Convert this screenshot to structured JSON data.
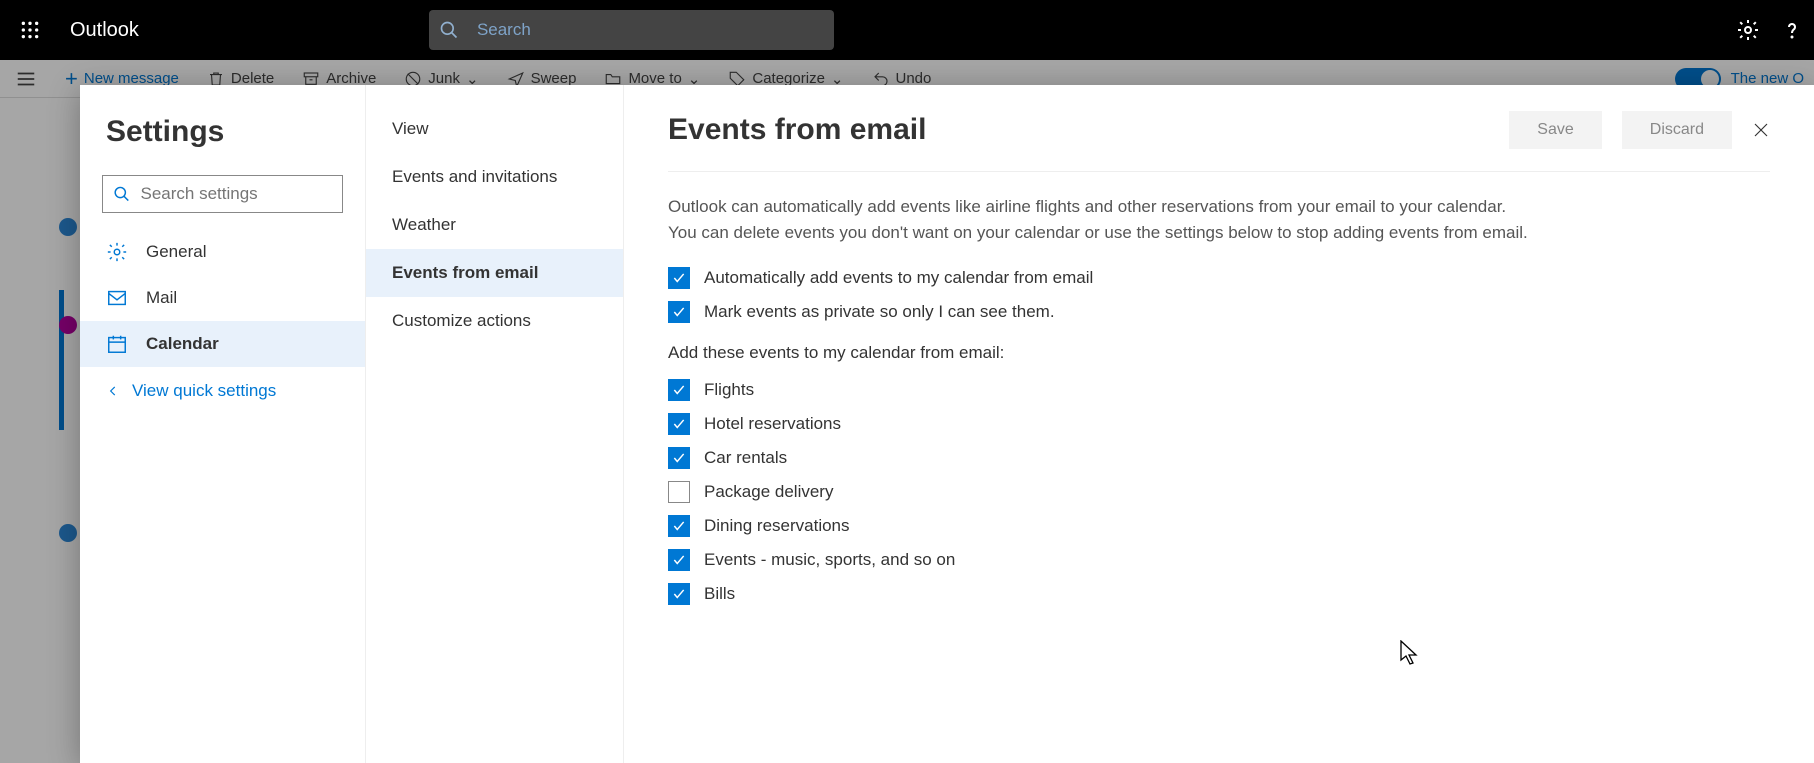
{
  "header": {
    "app_name": "Outlook",
    "search_placeholder": "Search"
  },
  "toolbar": {
    "new_message": "New message",
    "delete": "Delete",
    "archive": "Archive",
    "junk": "Junk",
    "sweep": "Sweep",
    "move_to": "Move to",
    "categorize": "Categorize",
    "undo": "Undo",
    "new_toggle_label": "The new O"
  },
  "settings": {
    "title": "Settings",
    "search_placeholder": "Search settings",
    "nav": {
      "general": "General",
      "mail": "Mail",
      "calendar": "Calendar"
    },
    "quick": "View quick settings"
  },
  "subnav": {
    "view": "View",
    "events_invitations": "Events and invitations",
    "weather": "Weather",
    "events_from_email": "Events from email",
    "customize_actions": "Customize actions"
  },
  "panel": {
    "title": "Events from email",
    "save": "Save",
    "discard": "Discard",
    "description": "Outlook can automatically add events like airline flights and other reservations from your email to your calendar. You can delete events you don't want on your calendar or use the settings below to stop adding events from email.",
    "auto_add": "Automatically add events to my calendar from email",
    "mark_private": "Mark events as private so only I can see them.",
    "add_these": "Add these events to my calendar from email:",
    "event_types": [
      {
        "label": "Flights",
        "checked": true
      },
      {
        "label": "Hotel reservations",
        "checked": true
      },
      {
        "label": "Car rentals",
        "checked": true
      },
      {
        "label": "Package delivery",
        "checked": false
      },
      {
        "label": "Dining reservations",
        "checked": true
      },
      {
        "label": "Events - music, sports, and so on",
        "checked": true
      },
      {
        "label": "Bills",
        "checked": true
      }
    ]
  }
}
